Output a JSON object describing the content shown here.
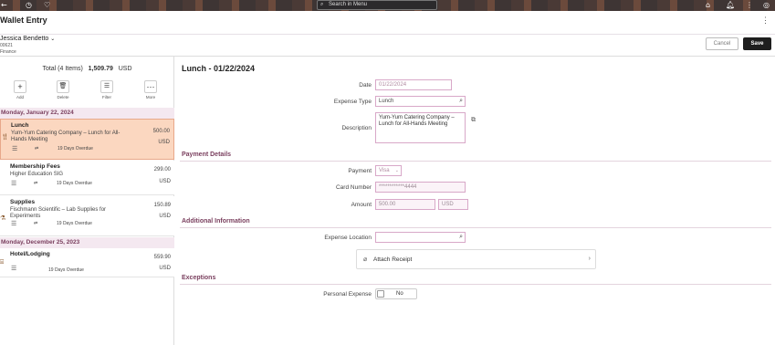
{
  "browser": {
    "search_placeholder": "Search in Menu"
  },
  "header": {
    "title": "Wallet Entry"
  },
  "user": {
    "name": "Jessica Bendetto",
    "id": "00621",
    "department": "Finance"
  },
  "actions": {
    "cancel_label": "Cancel",
    "save_label": "Save"
  },
  "summary": {
    "label": "Total (4 Items)",
    "amount": "1,509.79",
    "currency": "USD"
  },
  "toolbar": [
    {
      "label": "Add",
      "icon": "+"
    },
    {
      "label": "Delete",
      "icon": "🗑"
    },
    {
      "label": "Filter",
      "icon": "☰"
    },
    {
      "label": "More",
      "icon": "⋯"
    }
  ],
  "groups": [
    {
      "date": "Monday, January 22, 2024"
    },
    {
      "date": "Monday, December 25, 2023"
    }
  ],
  "items": [
    {
      "title": "Lunch",
      "description": "Yum-Yum Catering Company – Lunch for All-Hands Meeting",
      "amount": "500.00",
      "currency": "USD",
      "status": "19 Days Overdue"
    },
    {
      "title": "Membership Fees",
      "description": "Higher Education SIG",
      "amount": "299.00",
      "currency": "USD",
      "status": "19 Days Overdue"
    },
    {
      "title": "Supplies",
      "description": "Fischmann Scientific – Lab Supplies for Experiments",
      "amount": "150.89",
      "currency": "USD",
      "status": "19 Days Overdue"
    },
    {
      "title": "Hotel/Lodging",
      "description": "",
      "amount": "559.90",
      "currency": "USD",
      "status": "19 Days Overdue"
    }
  ],
  "detail": {
    "title": "Lunch - 01/22/2024",
    "date_label": "Date",
    "date_value": "01/22/2024",
    "expense_type_label": "Expense Type",
    "expense_type_value": "Lunch",
    "description_label": "Description",
    "description_value": "Yum-Yum Catering Company – Lunch for All-Hands Meeting",
    "payment_section": "Payment Details",
    "payment_label": "Payment",
    "payment_value": "Visa",
    "card_label": "Card Number",
    "card_value": "************4444",
    "amount_label": "Amount",
    "amount_value": "500.00",
    "amount_currency": "USD",
    "additional_section": "Additional Information",
    "location_label": "Expense Location",
    "location_value": "",
    "attach_label": "Attach Receipt",
    "exceptions_section": "Exceptions",
    "personal_label": "Personal Expense",
    "personal_value": "No"
  }
}
